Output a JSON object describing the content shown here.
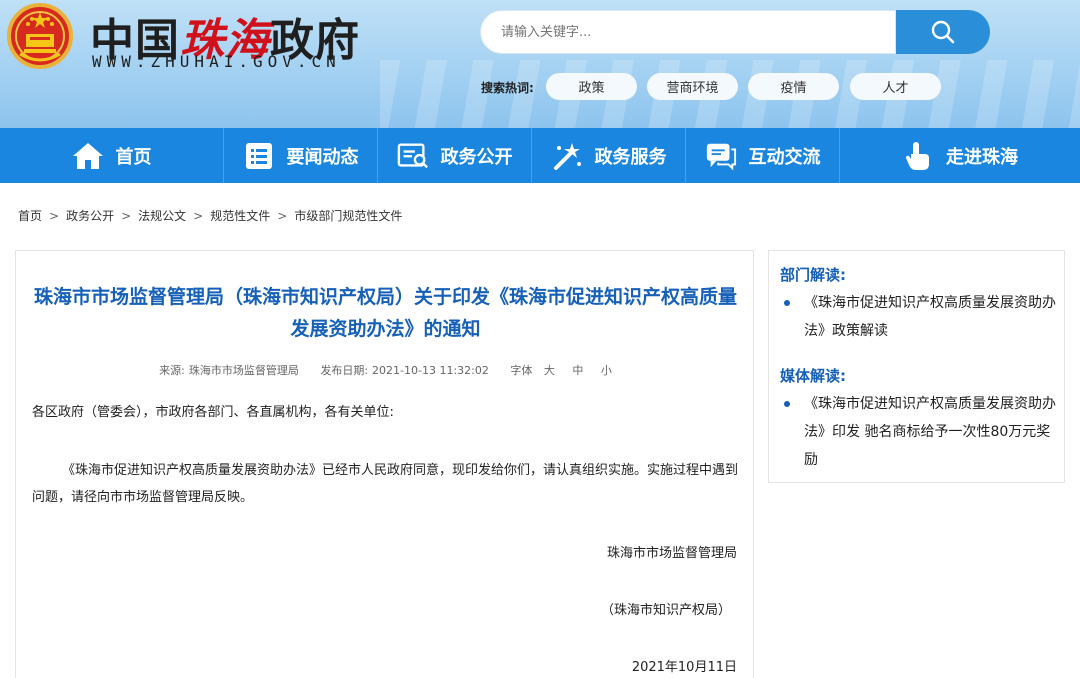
{
  "header": {
    "logo_title_black1": "中国",
    "logo_title_red": "珠海",
    "logo_title_black2": "政府",
    "logo_url": "WWW.ZHUHAI.GOV.CN",
    "search_placeholder": "请输入关键字...",
    "hot_label": "搜索热词:",
    "hot_words": [
      "政策",
      "营商环境",
      "疫情",
      "人才"
    ]
  },
  "nav": {
    "items": [
      "首页",
      "要闻动态",
      "政务公开",
      "政务服务",
      "互动交流",
      "走进珠海"
    ]
  },
  "breadcrumb": [
    "首页",
    "政务公开",
    "法规公文",
    "规范性文件",
    "市级部门规范性文件"
  ],
  "article": {
    "title": "珠海市市场监督管理局（珠海市知识产权局）关于印发《珠海市促进知识产权高质量发展资助办法》的通知",
    "source_label": "来源:",
    "source": "珠海市市场监督管理局",
    "date_label": "发布日期:",
    "date": "2021-10-13 11:32:02",
    "font_label": "字体",
    "font_sizes": [
      "大",
      "中",
      "小"
    ],
    "salutation": "各区政府（管委会），市政府各部门、各直属机构，各有关单位:",
    "paragraph": "《珠海市促进知识产权高质量发展资助办法》已经市人民政府同意，现印发给你们，请认真组织实施。实施过程中遇到问题，请径向市市场监督管理局反映。",
    "signature1": "珠海市市场监督管理局",
    "signature2": "（珠海市知识产权局）",
    "sign_date": "2021年10月11日"
  },
  "sidebar": {
    "dept_head": "部门解读:",
    "dept_items": [
      "《珠海市促进知识产权高质量发展资助办法》政策解读"
    ],
    "media_head": "媒体解读:",
    "media_items": [
      "《珠海市促进知识产权高质量发展资助办法》印发 驰名商标给予一次性80万元奖励"
    ]
  },
  "colors": {
    "nav_bg": "#1a86df",
    "title_blue": "#1660b8",
    "logo_red": "#d0101a"
  }
}
